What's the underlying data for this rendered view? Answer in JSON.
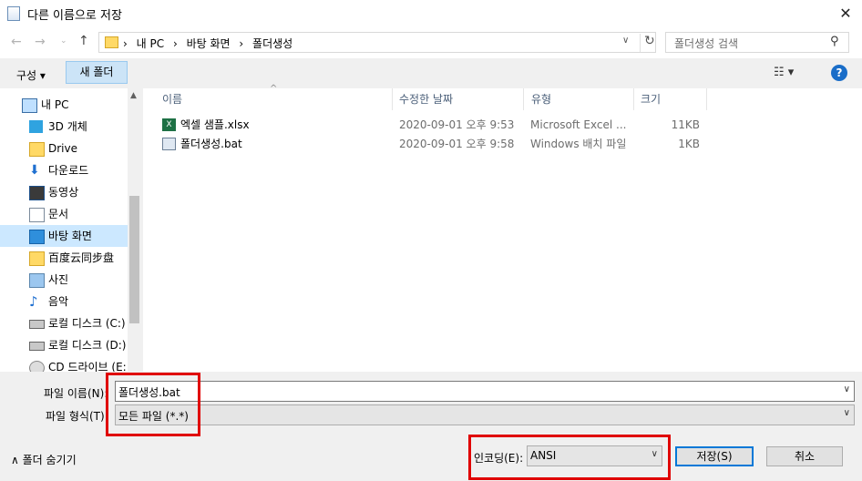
{
  "window": {
    "title": "다른 이름으로 저장"
  },
  "nav": {
    "breadcrumb": [
      "내 PC",
      "바탕 화면",
      "폴더생성"
    ],
    "search_placeholder": "폴더생성 검색"
  },
  "toolbar": {
    "organize_label": "구성 ▾",
    "new_folder_label": "새 폴더",
    "help_label": "?"
  },
  "sidebar": {
    "items": [
      {
        "label": "내 PC",
        "icon": "pc-icon"
      },
      {
        "label": "3D 개체",
        "icon": "cube-icon"
      },
      {
        "label": "Drive",
        "icon": "folder-icon"
      },
      {
        "label": "다운로드",
        "icon": "download-icon"
      },
      {
        "label": "동영상",
        "icon": "video-icon"
      },
      {
        "label": "문서",
        "icon": "document-icon"
      },
      {
        "label": "바탕 화면",
        "icon": "desktop-icon",
        "selected": true
      },
      {
        "label": "百度云同步盘",
        "icon": "folder-icon"
      },
      {
        "label": "사진",
        "icon": "picture-icon"
      },
      {
        "label": "음악",
        "icon": "music-icon"
      },
      {
        "label": "로컬 디스크 (C:)",
        "icon": "drive-icon"
      },
      {
        "label": "로컬 디스크 (D:)",
        "icon": "drive-icon"
      },
      {
        "label": "CD 드라이브 (E:",
        "icon": "cd-icon"
      }
    ]
  },
  "files": {
    "columns": [
      "이름",
      "수정한 날짜",
      "유형",
      "크기"
    ],
    "rows": [
      {
        "name": "엑셀 샘플.xlsx",
        "date": "2020-09-01 오후 9:53",
        "type": "Microsoft Excel ...",
        "size": "11KB",
        "icon": "excel-icon"
      },
      {
        "name": "폴더생성.bat",
        "date": "2020-09-01 오후 9:58",
        "type": "Windows 배치 파일",
        "size": "1KB",
        "icon": "batch-file-icon"
      }
    ]
  },
  "form": {
    "filename_label": "파일 이름(N):",
    "filename_value": "폴더생성.bat",
    "filetype_label": "파일 형식(T):",
    "filetype_value": "모든 파일 (*.*)",
    "encoding_label": "인코딩(E):",
    "encoding_value": "ANSI"
  },
  "buttons": {
    "save": "저장(S)",
    "cancel": "취소",
    "hide_folders": "폴더 숨기기"
  },
  "colors": {
    "accent": "#0078d7",
    "highlight": "#e00000",
    "selection": "#cce8ff"
  }
}
